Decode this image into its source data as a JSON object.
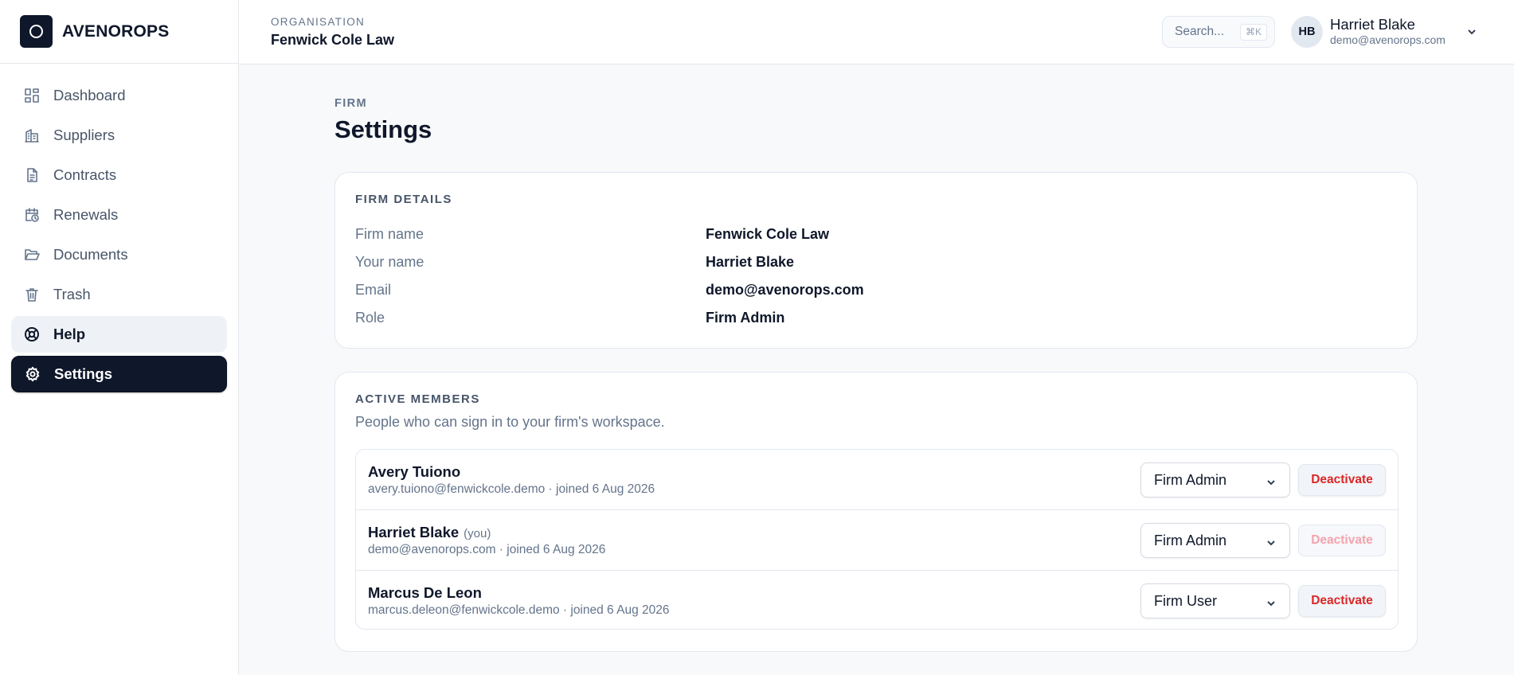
{
  "brand": {
    "name": "AVENOROPS"
  },
  "sidebar": {
    "items": [
      {
        "label": "Dashboard",
        "icon": "dashboard-icon"
      },
      {
        "label": "Suppliers",
        "icon": "building-icon"
      },
      {
        "label": "Contracts",
        "icon": "document-icon"
      },
      {
        "label": "Renewals",
        "icon": "calendar-clock-icon"
      },
      {
        "label": "Documents",
        "icon": "folder-open-icon"
      },
      {
        "label": "Trash",
        "icon": "trash-icon"
      },
      {
        "label": "Help",
        "icon": "lifebuoy-icon"
      },
      {
        "label": "Settings",
        "icon": "gear-icon",
        "active": true
      }
    ]
  },
  "header": {
    "org_label": "ORGANISATION",
    "org_name": "Fenwick Cole Law",
    "search_placeholder": "Search...",
    "search_shortcut": "⌘K",
    "user": {
      "initials": "HB",
      "name": "Harriet Blake",
      "email": "demo@avenorops.com"
    }
  },
  "page": {
    "eyebrow": "FIRM",
    "title": "Settings"
  },
  "firm_details": {
    "title": "FIRM DETAILS",
    "rows": [
      {
        "label": "Firm name",
        "value": "Fenwick Cole Law"
      },
      {
        "label": "Your name",
        "value": "Harriet Blake"
      },
      {
        "label": "Email",
        "value": "demo@avenorops.com"
      },
      {
        "label": "Role",
        "value": "Firm Admin"
      }
    ]
  },
  "members": {
    "title": "ACTIVE MEMBERS",
    "subtitle": "People who can sign in to your firm's workspace.",
    "rows": [
      {
        "name": "Avery Tuiono",
        "you": "",
        "meta": "avery.tuiono@fenwickcole.demo · joined 6 Aug 2026",
        "role": "Firm Admin",
        "action": "Deactivate",
        "action_enabled": true
      },
      {
        "name": "Harriet Blake",
        "you": "(you)",
        "meta": "demo@avenorops.com · joined 6 Aug 2026",
        "role": "Firm Admin",
        "action": "Deactivate",
        "action_enabled": false
      },
      {
        "name": "Marcus De Leon",
        "you": "",
        "meta": "marcus.deleon@fenwickcole.demo · joined 6 Aug 2026",
        "role": "Firm User",
        "action": "Deactivate",
        "action_enabled": true
      }
    ]
  },
  "colors": {
    "accent_dark": "#0f172a",
    "danger": "#dc2626",
    "danger_disabled": "#f4a3ad",
    "background": "#f7f9fb"
  }
}
